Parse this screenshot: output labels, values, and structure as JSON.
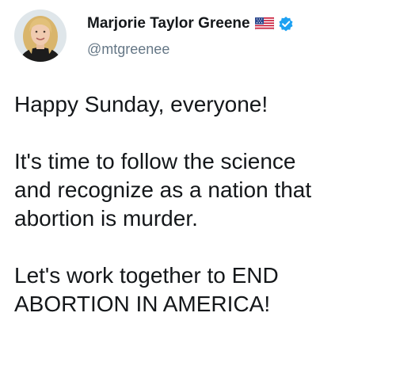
{
  "author": {
    "display_name": "Marjorie Taylor Greene",
    "handle": "@mtgreenee",
    "avatar_icon": "profile-photo",
    "flag_icon": "us-flag-icon",
    "verified_icon": "verified-badge-icon",
    "verified_color": "#1da1f2"
  },
  "tweet": {
    "line_1": "Happy Sunday, everyone!",
    "line_2": "It's time to follow the science",
    "line_3": "and recognize as a nation that",
    "line_4": "abortion is murder.",
    "line_5": "Let's work together to END",
    "line_6": "ABORTION IN AMERICA!"
  }
}
